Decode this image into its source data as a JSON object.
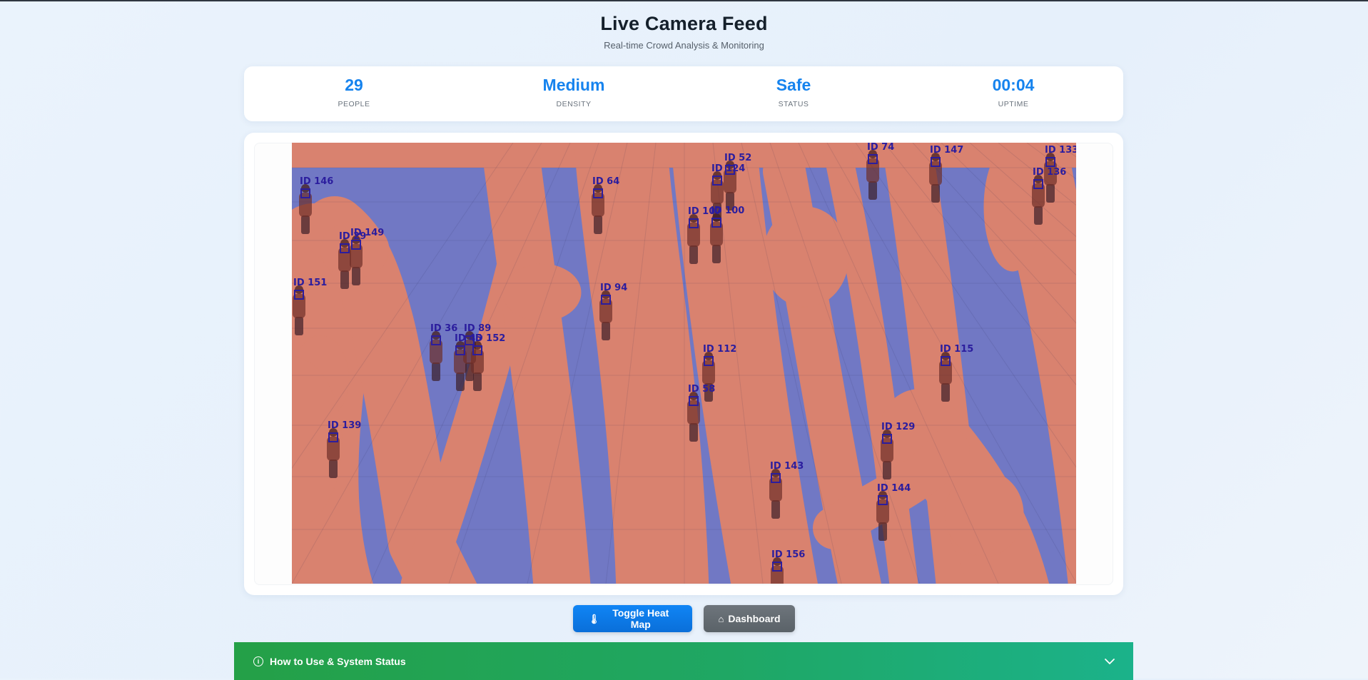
{
  "header": {
    "title": "Live Camera Feed",
    "subtitle": "Real-time Crowd Analysis & Monitoring"
  },
  "stats": [
    {
      "value": "29",
      "label": "PEOPLE"
    },
    {
      "value": "Medium",
      "label": "DENSITY"
    },
    {
      "value": "Safe",
      "label": "STATUS"
    },
    {
      "value": "00:04",
      "label": "UPTIME"
    }
  ],
  "feed": {
    "heatmap_colors": {
      "hot": "#d9826f",
      "cold": "#7178c4"
    },
    "box_color": "#2b1d9e",
    "detections": [
      {
        "id": "ID 146"
      },
      {
        "id": "ID 149"
      },
      {
        "id": "ID 29"
      },
      {
        "id": "ID 151"
      },
      {
        "id": "ID 36"
      },
      {
        "id": "ID 45"
      },
      {
        "id": "ID 89"
      },
      {
        "id": "ID 152"
      },
      {
        "id": "ID 139"
      },
      {
        "id": "ID 64"
      },
      {
        "id": "ID 94"
      },
      {
        "id": "ID 107"
      },
      {
        "id": "ID 100"
      },
      {
        "id": "ID 112"
      },
      {
        "id": "ID 58"
      },
      {
        "id": "ID 143"
      },
      {
        "id": "ID 156"
      },
      {
        "id": "ID 74"
      },
      {
        "id": "ID 52"
      },
      {
        "id": "ID 124"
      },
      {
        "id": "ID 147"
      },
      {
        "id": "ID 133"
      },
      {
        "id": "ID 136"
      },
      {
        "id": "ID 115"
      },
      {
        "id": "ID 129"
      },
      {
        "id": "ID 144"
      }
    ]
  },
  "controls": {
    "heatmap_button": "Toggle Heat Map",
    "heatmap_icon": "thermometer-icon",
    "dashboard_button": "Dashboard",
    "dashboard_icon": "home-icon"
  },
  "status_bar": {
    "title": "How to Use & System Status",
    "icon": "info-icon",
    "chevron": "chevron-down-icon"
  }
}
